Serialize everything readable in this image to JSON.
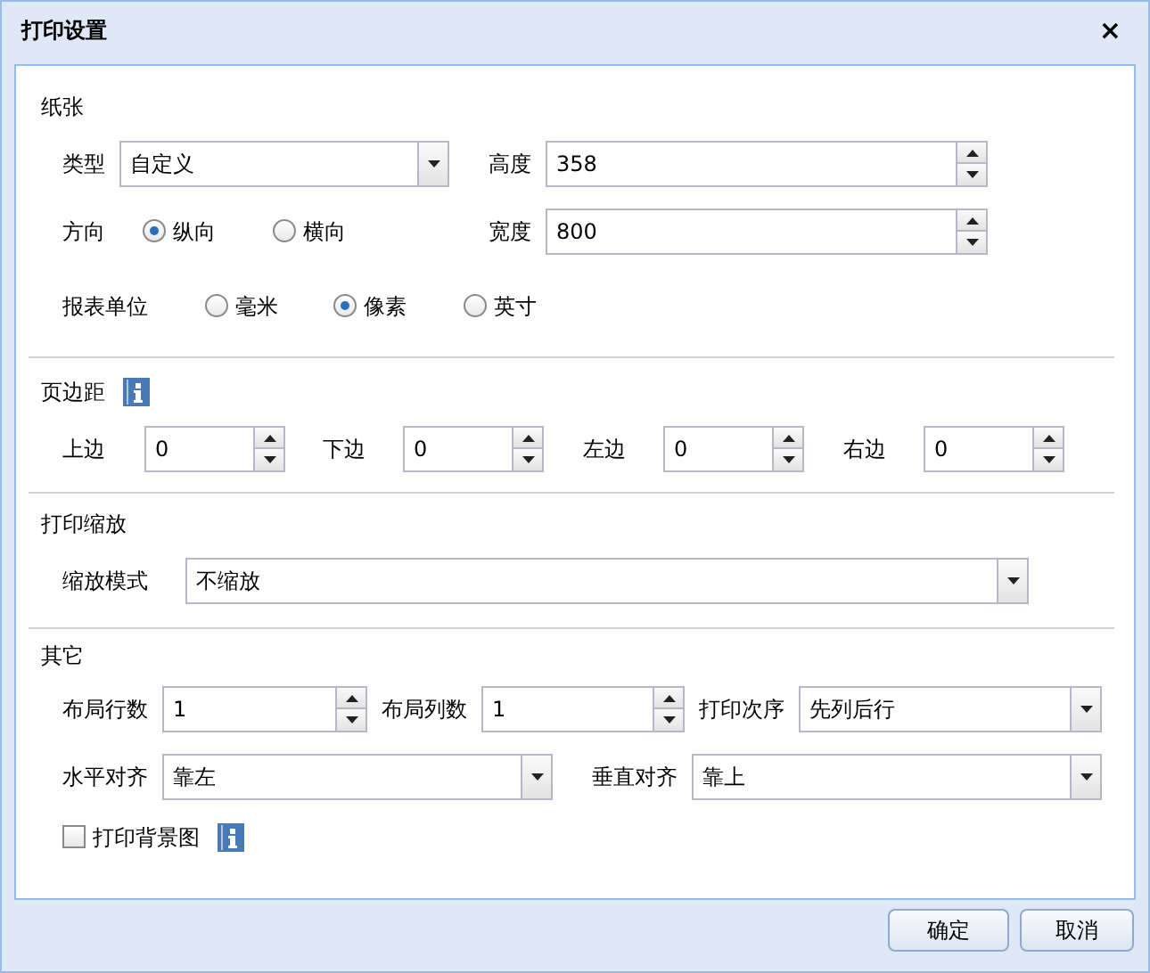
{
  "window": {
    "title": "打印设置",
    "close": "×"
  },
  "sections": [
    {
      "header": [
        {
          "kind": "title",
          "text": "纸张"
        }
      ],
      "rows": [
        [
          {
            "label": "类型",
            "kind": "select",
            "value": "自定义"
          },
          {
            "label": "高度",
            "kind": "spinner",
            "value": "358"
          }
        ],
        [
          {
            "label": "方向",
            "kind": "radio_group",
            "options": [
              {
                "text": "纵向",
                "selected": true
              },
              {
                "text": "横向",
                "selected": false
              }
            ]
          },
          {
            "label": "宽度",
            "kind": "spinner",
            "value": "800"
          }
        ],
        [
          {
            "label": "报表单位",
            "kind": "radio_group",
            "options": [
              {
                "text": "毫米",
                "selected": false
              },
              {
                "text": "像素",
                "selected": true
              },
              {
                "text": "英寸",
                "selected": false
              }
            ]
          }
        ]
      ]
    },
    {
      "header": [
        {
          "kind": "title",
          "text": "页边距"
        },
        {
          "kind": "info"
        }
      ],
      "rows": [
        [
          {
            "label": "上边",
            "kind": "spinner",
            "value": "0"
          },
          {
            "label": "下边",
            "kind": "spinner",
            "value": "0"
          },
          {
            "label": "左边",
            "kind": "spinner",
            "value": "0"
          },
          {
            "label": "右边",
            "kind": "spinner",
            "value": "0"
          }
        ]
      ]
    },
    {
      "header": [
        {
          "kind": "title",
          "text": "打印缩放"
        }
      ],
      "rows": [
        [
          {
            "label": "缩放模式",
            "kind": "select",
            "value": "不缩放"
          }
        ]
      ]
    },
    {
      "header": [
        {
          "kind": "title",
          "text": "其它"
        }
      ],
      "rows": [
        [
          {
            "label": "布局行数",
            "kind": "spinner",
            "value": "1"
          },
          {
            "label": "布局列数",
            "kind": "spinner",
            "value": "1"
          },
          {
            "label": "打印次序",
            "kind": "select",
            "value": "先列后行"
          }
        ],
        [
          {
            "label": "水平对齐",
            "kind": "select",
            "value": "靠左"
          },
          {
            "label": "垂直对齐",
            "kind": "select",
            "value": "靠上"
          }
        ],
        [
          {
            "kind": "checkbox",
            "text": "打印背景图",
            "checked": false,
            "info": true
          }
        ]
      ]
    }
  ],
  "buttons": [
    "确定",
    "取消"
  ]
}
